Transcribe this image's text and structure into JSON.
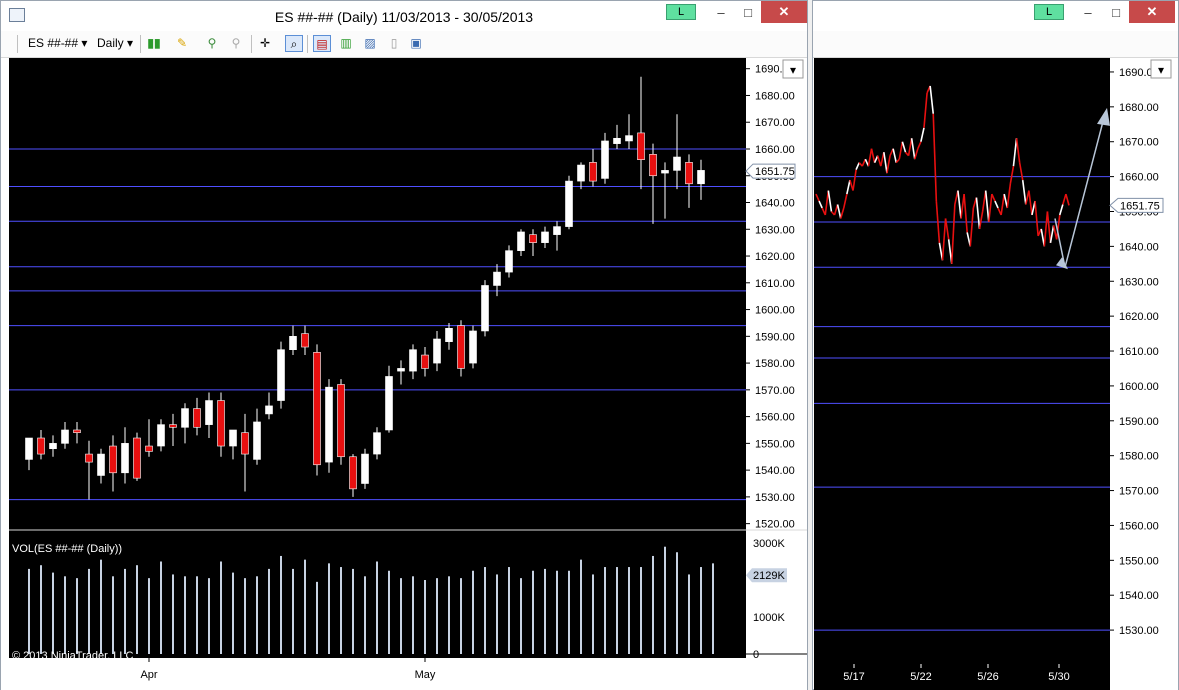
{
  "colors": {
    "background": "#000000",
    "grid": "#4f4fff",
    "up_candle": "#ffffff",
    "down_candle": "#e81010",
    "volume_bar": "#c7d2e2",
    "price_marker": "#c7d2e2",
    "axis_text": "#000000",
    "arrow": "#b8c6d8"
  },
  "left_window": {
    "title": "ES ##-## (Daily)  11/03/2013 - 30/05/2013",
    "l_button": "L",
    "controls": {
      "minimize": "–",
      "maximize": "□",
      "close": "✕"
    },
    "toolbar": {
      "instrument": "ES ##-##",
      "interval": "Daily"
    },
    "icons": [
      "bar-type-icon",
      "drawing-pencil-icon",
      "indicator-icon",
      "strategy-icon",
      "crosshair-icon",
      "zoom-icon",
      "chart-trader-icon",
      "candle-style-icon",
      "data-box-icon",
      "properties-icon",
      "template-icon"
    ],
    "scroll_button": "▾",
    "price_axis": {
      "ticks": [
        "1690.00",
        "1680.00",
        "1670.00",
        "1660.00",
        "1650.00",
        "1640.00",
        "1630.00",
        "1620.00",
        "1610.00",
        "1600.00",
        "1590.00",
        "1580.00",
        "1570.00",
        "1560.00",
        "1550.00",
        "1540.00",
        "1530.00",
        "1520.00"
      ]
    },
    "last_price": "1651.75",
    "volume_label": "VOL(ES ##-## (Daily))",
    "volume_axis": {
      "ticks": [
        "3000K",
        "1000K",
        "0"
      ]
    },
    "volume_marker": "2129K",
    "copyright": "© 2013 NinjaTrader, LLC",
    "date_labels": [
      "Apr",
      "May"
    ]
  },
  "right_window": {
    "l_button": "L",
    "controls": {
      "minimize": "–",
      "maximize": "□",
      "close": "✕"
    },
    "scroll_button": "▾",
    "price_axis": {
      "ticks": [
        "1690.00",
        "1680.00",
        "1670.00",
        "1660.00",
        "1650.00",
        "1640.00",
        "1630.00",
        "1620.00",
        "1610.00",
        "1600.00",
        "1590.00",
        "1580.00",
        "1570.00",
        "1560.00",
        "1550.00",
        "1540.00",
        "1530.00"
      ]
    },
    "last_price": "1651.75",
    "date_labels": [
      "5/17",
      "5/22",
      "5/26",
      "5/30"
    ]
  },
  "chart_data": [
    {
      "type": "candlestick",
      "ylim": [
        1518,
        1694
      ],
      "hlines": [
        1660,
        1646,
        1633,
        1616,
        1607,
        1594,
        1570,
        1529
      ],
      "candles": [
        {
          "o": 1544,
          "h": 1550,
          "l": 1540,
          "c": 1552,
          "up": true
        },
        {
          "o": 1552,
          "h": 1555,
          "l": 1544,
          "c": 1546,
          "up": false
        },
        {
          "o": 1548,
          "h": 1553,
          "l": 1545,
          "c": 1550,
          "up": true
        },
        {
          "o": 1550,
          "h": 1558,
          "l": 1548,
          "c": 1555,
          "up": true
        },
        {
          "o": 1555,
          "h": 1558,
          "l": 1550,
          "c": 1554,
          "up": false
        },
        {
          "o": 1546,
          "h": 1551,
          "l": 1529,
          "c": 1543,
          "up": false
        },
        {
          "o": 1538,
          "h": 1548,
          "l": 1535,
          "c": 1546,
          "up": true
        },
        {
          "o": 1549,
          "h": 1553,
          "l": 1532,
          "c": 1539,
          "up": false
        },
        {
          "o": 1539,
          "h": 1556,
          "l": 1535,
          "c": 1550,
          "up": true
        },
        {
          "o": 1552,
          "h": 1554,
          "l": 1536,
          "c": 1537,
          "up": false
        },
        {
          "o": 1547,
          "h": 1559,
          "l": 1545,
          "c": 1549,
          "up": false
        },
        {
          "o": 1549,
          "h": 1559,
          "l": 1547,
          "c": 1557,
          "up": true
        },
        {
          "o": 1557,
          "h": 1561,
          "l": 1549,
          "c": 1556,
          "up": false
        },
        {
          "o": 1556,
          "h": 1565,
          "l": 1550,
          "c": 1563,
          "up": true
        },
        {
          "o": 1563,
          "h": 1567,
          "l": 1553,
          "c": 1556,
          "up": false
        },
        {
          "o": 1557,
          "h": 1569,
          "l": 1552,
          "c": 1566,
          "up": true
        },
        {
          "o": 1566,
          "h": 1569,
          "l": 1545,
          "c": 1549,
          "up": false
        },
        {
          "o": 1549,
          "h": 1555,
          "l": 1544,
          "c": 1555,
          "up": true
        },
        {
          "o": 1554,
          "h": 1561,
          "l": 1532,
          "c": 1546,
          "up": false
        },
        {
          "o": 1544,
          "h": 1563,
          "l": 1542,
          "c": 1558,
          "up": true
        },
        {
          "o": 1561,
          "h": 1569,
          "l": 1559,
          "c": 1564,
          "up": true
        },
        {
          "o": 1566,
          "h": 1588,
          "l": 1563,
          "c": 1585,
          "up": true
        },
        {
          "o": 1585,
          "h": 1594,
          "l": 1583,
          "c": 1590,
          "up": true
        },
        {
          "o": 1591,
          "h": 1594,
          "l": 1583,
          "c": 1586,
          "up": false
        },
        {
          "o": 1584,
          "h": 1587,
          "l": 1538,
          "c": 1542,
          "up": false
        },
        {
          "o": 1543,
          "h": 1574,
          "l": 1539,
          "c": 1571,
          "up": true
        },
        {
          "o": 1572,
          "h": 1574,
          "l": 1542,
          "c": 1545,
          "up": false
        },
        {
          "o": 1545,
          "h": 1546,
          "l": 1530,
          "c": 1533,
          "up": false
        },
        {
          "o": 1535,
          "h": 1548,
          "l": 1533,
          "c": 1546,
          "up": true
        },
        {
          "o": 1546,
          "h": 1556,
          "l": 1544,
          "c": 1554,
          "up": true
        },
        {
          "o": 1555,
          "h": 1579,
          "l": 1554,
          "c": 1575,
          "up": true
        },
        {
          "o": 1577,
          "h": 1581,
          "l": 1572,
          "c": 1578,
          "up": true
        },
        {
          "o": 1577,
          "h": 1587,
          "l": 1574,
          "c": 1585,
          "up": true
        },
        {
          "o": 1583,
          "h": 1586,
          "l": 1575,
          "c": 1578,
          "up": false
        },
        {
          "o": 1580,
          "h": 1592,
          "l": 1577,
          "c": 1589,
          "up": true
        },
        {
          "o": 1588,
          "h": 1595,
          "l": 1585,
          "c": 1593,
          "up": true
        },
        {
          "o": 1594,
          "h": 1596,
          "l": 1575,
          "c": 1578,
          "up": false
        },
        {
          "o": 1580,
          "h": 1594,
          "l": 1578,
          "c": 1592,
          "up": true
        },
        {
          "o": 1592,
          "h": 1611,
          "l": 1590,
          "c": 1609,
          "up": true
        },
        {
          "o": 1609,
          "h": 1617,
          "l": 1605,
          "c": 1614,
          "up": true
        },
        {
          "o": 1614,
          "h": 1624,
          "l": 1612,
          "c": 1622,
          "up": true
        },
        {
          "o": 1622,
          "h": 1630,
          "l": 1620,
          "c": 1629,
          "up": true
        },
        {
          "o": 1628,
          "h": 1630,
          "l": 1620,
          "c": 1625,
          "up": false
        },
        {
          "o": 1625,
          "h": 1631,
          "l": 1623,
          "c": 1629,
          "up": true
        },
        {
          "o": 1628,
          "h": 1633,
          "l": 1622,
          "c": 1631,
          "up": true
        },
        {
          "o": 1631,
          "h": 1650,
          "l": 1630,
          "c": 1648,
          "up": true
        },
        {
          "o": 1648,
          "h": 1655,
          "l": 1645,
          "c": 1654,
          "up": true
        },
        {
          "o": 1655,
          "h": 1660,
          "l": 1646,
          "c": 1648,
          "up": false
        },
        {
          "o": 1649,
          "h": 1666,
          "l": 1647,
          "c": 1663,
          "up": true
        },
        {
          "o": 1662,
          "h": 1669,
          "l": 1660,
          "c": 1664,
          "up": true
        },
        {
          "o": 1663,
          "h": 1673,
          "l": 1660,
          "c": 1665,
          "up": true
        },
        {
          "o": 1666,
          "h": 1687,
          "l": 1645,
          "c": 1656,
          "up": false
        },
        {
          "o": 1658,
          "h": 1662,
          "l": 1632,
          "c": 1650,
          "up": false
        },
        {
          "o": 1651,
          "h": 1655,
          "l": 1634,
          "c": 1652,
          "up": true
        },
        {
          "o": 1652,
          "h": 1673,
          "l": 1645,
          "c": 1657,
          "up": true
        },
        {
          "o": 1655,
          "h": 1658,
          "l": 1638,
          "c": 1647,
          "up": false
        },
        {
          "o": 1647,
          "h": 1656,
          "l": 1641,
          "c": 1652,
          "up": true
        }
      ],
      "volume": {
        "ylim": [
          0,
          3000
        ],
        "values": [
          2300,
          2400,
          2200,
          2100,
          2050,
          2300,
          2550,
          2100,
          2300,
          2400,
          2050,
          2500,
          2150,
          2100,
          2100,
          2050,
          2500,
          2200,
          2050,
          2100,
          2300,
          2650,
          2300,
          2550,
          1950,
          2450,
          2350,
          2300,
          2100,
          2500,
          2250,
          2050,
          2100,
          2000,
          2050,
          2100,
          2050,
          2250,
          2350,
          2150,
          2350,
          2050,
          2250,
          2300,
          2250,
          2250,
          2550,
          2150,
          2350,
          2350,
          2350,
          2350,
          2650,
          2900,
          2750,
          2150,
          2350,
          2450
        ]
      }
    },
    {
      "type": "line",
      "ylim": [
        1522,
        1694
      ],
      "hlines": [
        1660,
        1647,
        1634,
        1617,
        1608,
        1595,
        1571,
        1530
      ],
      "series": [
        {
          "values": [
            1655,
            1653,
            1651,
            1649,
            1656,
            1650,
            1649,
            1652,
            1648,
            1651,
            1655,
            1659,
            1656,
            1662,
            1664,
            1663,
            1665,
            1663,
            1668,
            1664,
            1666,
            1663,
            1667,
            1661,
            1666,
            1668,
            1664,
            1665,
            1670,
            1667,
            1666,
            1671,
            1665,
            1668,
            1670,
            1674,
            1684,
            1686,
            1678,
            1653,
            1641,
            1636,
            1648,
            1642,
            1635,
            1652,
            1656,
            1648,
            1655,
            1644,
            1640,
            1651,
            1654,
            1645,
            1650,
            1656,
            1647,
            1655,
            1653,
            1651,
            1649,
            1655,
            1651,
            1658,
            1663,
            1671,
            1664,
            1659,
            1652,
            1656,
            1649,
            1653,
            1643,
            1645,
            1640,
            1650,
            1641,
            1646,
            1642,
            1649,
            1652,
            1655,
            1651.75
          ]
        }
      ],
      "annotations": [
        {
          "type": "arrow",
          "from": [
            1635,
            1640
          ],
          "to": [
            1678,
            1647
          ],
          "note": "data-units arrow from pullback low up toward 1678"
        }
      ]
    }
  ]
}
